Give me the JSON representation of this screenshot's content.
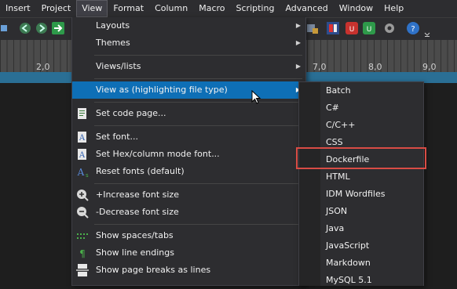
{
  "menubar": {
    "items": [
      "Insert",
      "Project",
      "View",
      "Format",
      "Column",
      "Macro",
      "Scripting",
      "Advanced",
      "Window",
      "Help"
    ],
    "active": "View"
  },
  "ruler": {
    "ticks": [
      "2,0",
      "7,0",
      "8,0",
      "9,0"
    ]
  },
  "view_menu": {
    "items": [
      {
        "label": "Layouts",
        "submenu": true
      },
      {
        "label": "Themes",
        "submenu": true
      },
      {
        "label": "Views/lists",
        "submenu": true
      },
      {
        "label": "View as (highlighting file type)",
        "submenu": true,
        "highlighted": true
      },
      {
        "label": "Set code page..."
      },
      {
        "label": "Set font..."
      },
      {
        "label": "Set Hex/column mode font..."
      },
      {
        "label": "Reset fonts (default)"
      },
      {
        "label": "+Increase font size"
      },
      {
        "label": "-Decrease font size"
      },
      {
        "label": "Show spaces/tabs"
      },
      {
        "label": "Show line endings"
      },
      {
        "label": "Show page breaks as lines"
      }
    ]
  },
  "view_as_submenu": {
    "items": [
      "Batch",
      "C#",
      "C/C++",
      "CSS",
      "Dockerfile",
      "HTML",
      "IDM Wordfiles",
      "JSON",
      "Java",
      "JavaScript",
      "Markdown",
      "MySQL 5.1"
    ],
    "outlined_item": "Dockerfile"
  },
  "colors": {
    "menu_bg": "#2d2d30",
    "highlight": "#0e6fb6",
    "outline_red": "#d84c45",
    "editor_bg": "#1e1e1e",
    "status_blue": "#2a6f95"
  }
}
